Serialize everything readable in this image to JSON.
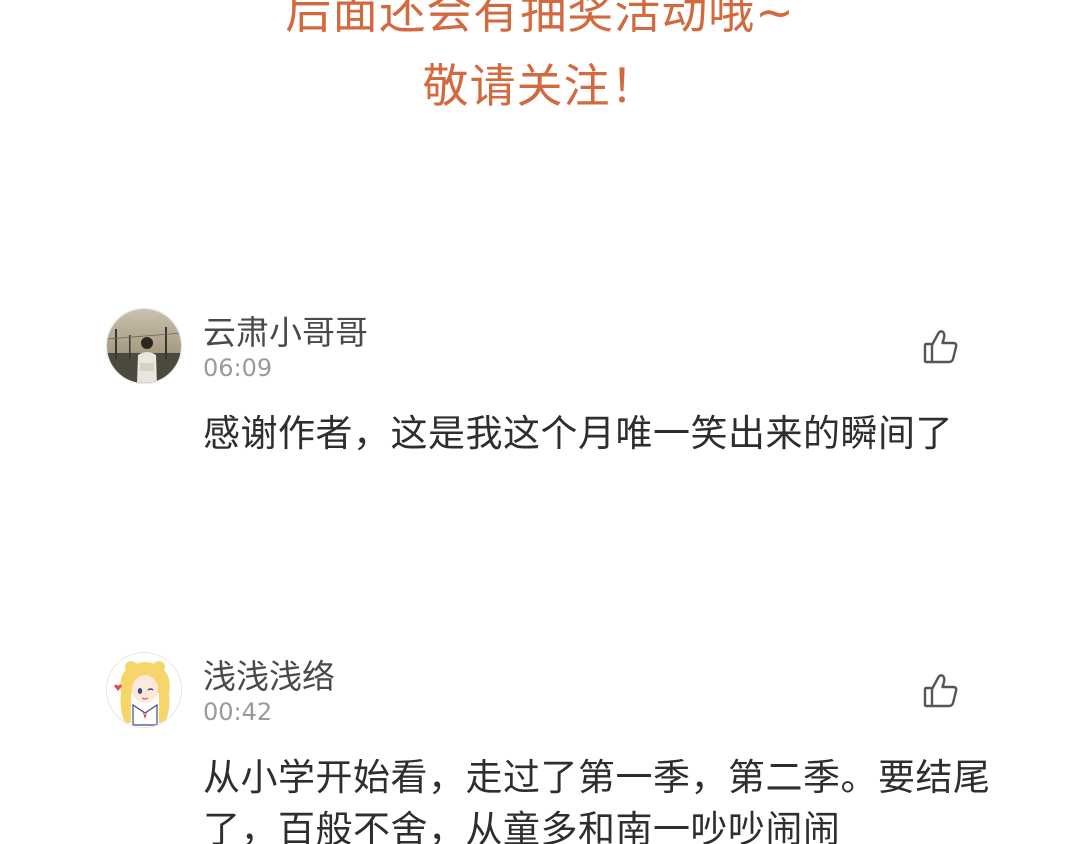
{
  "banner": {
    "line1": "后面还会有抽奖活动哦~",
    "line2": "敬请关注！",
    "color": "#d2693f"
  },
  "comments": [
    {
      "username": "云肃小哥哥",
      "time": "06:09",
      "text": "感谢作者，这是我这个月唯一笑出来的瞬间了",
      "avatar_icon": "avatar-photo-icon",
      "like_icon": "thumbs-up-icon"
    },
    {
      "username": "浅浅浅络",
      "time": "00:42",
      "text": "从小学开始看，走过了第一季，第二季。要结尾了，百般不舍，从童多和南一吵吵闹闹",
      "avatar_icon": "anime-girl-avatar-icon",
      "like_icon": "thumbs-up-icon"
    }
  ]
}
